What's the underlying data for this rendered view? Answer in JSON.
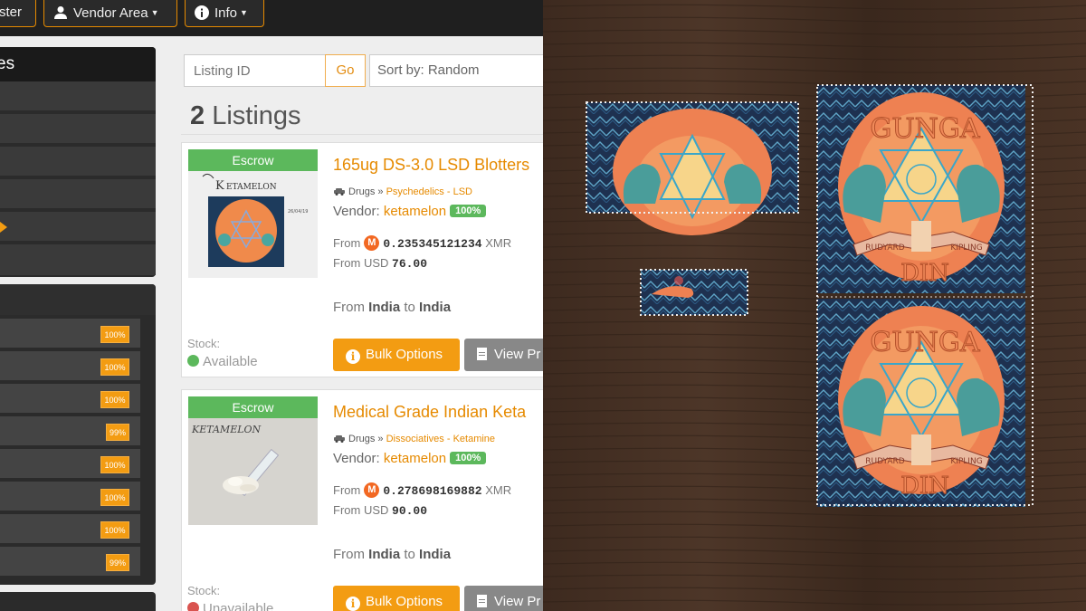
{
  "nav": {
    "register_partial": "ster",
    "vendor_area": "Vendor Area",
    "info": "Info"
  },
  "sidebar": {
    "title_partial": "es",
    "vendor_badges": [
      "100%",
      "100%",
      "100%",
      "99%",
      "100%",
      "100%",
      "100%",
      "99%"
    ]
  },
  "search": {
    "placeholder": "Listing ID",
    "go_label": "Go",
    "sort_label": "Sort by: Random"
  },
  "listings": {
    "count": "2",
    "label": "Listings",
    "items": [
      {
        "escrow": "Escrow",
        "title": "165ug DS-3.0 LSD Blotters",
        "category_root": "Drugs",
        "category": "Psychedelics",
        "subcategory": "LSD",
        "vendor_label": "Vendor:",
        "vendor": "ketamelon",
        "vendor_rating": "100%",
        "price_from_label": "From",
        "price_xmr": "0.235345121234",
        "xmr_label": "XMR",
        "price_usd_label": "From USD",
        "price_usd": "76.00",
        "route_from_label": "From",
        "origin": "India",
        "route_to_label": "to",
        "destination": "India",
        "stock_label": "Stock:",
        "stock_status": "Available",
        "stock_color": "#5cb85c",
        "bulk_label": "Bulk Options",
        "view_label": "View Pr",
        "thumb_text": "KETAMELON"
      },
      {
        "escrow": "Escrow",
        "title": "Medical Grade Indian Keta",
        "category_root": "Drugs",
        "category": "Dissociatives",
        "subcategory": "Ketamine",
        "vendor_label": "Vendor:",
        "vendor": "ketamelon",
        "vendor_rating": "100%",
        "price_from_label": "From",
        "price_xmr": "0.278698169882",
        "xmr_label": "XMR",
        "price_usd_label": "From USD",
        "price_usd": "90.00",
        "route_from_label": "From",
        "origin": "India",
        "route_to_label": "to",
        "destination": "India",
        "stock_label": "Stock:",
        "stock_status": "Unavailable",
        "stock_color": "#d9534f",
        "bulk_label": "Bulk Options",
        "view_label": "View Pr",
        "thumb_text": "KETAMELON"
      }
    ]
  },
  "photo": {
    "blotter_top_text": "GUNGA",
    "blotter_bottom_text": "DIN",
    "ribbon_left": "RUDYARD",
    "ribbon_right": "KIPLING"
  },
  "colors": {
    "accent": "#f39c12",
    "success": "#5cb85c",
    "danger": "#d9534f",
    "wood": "#4a3325"
  }
}
